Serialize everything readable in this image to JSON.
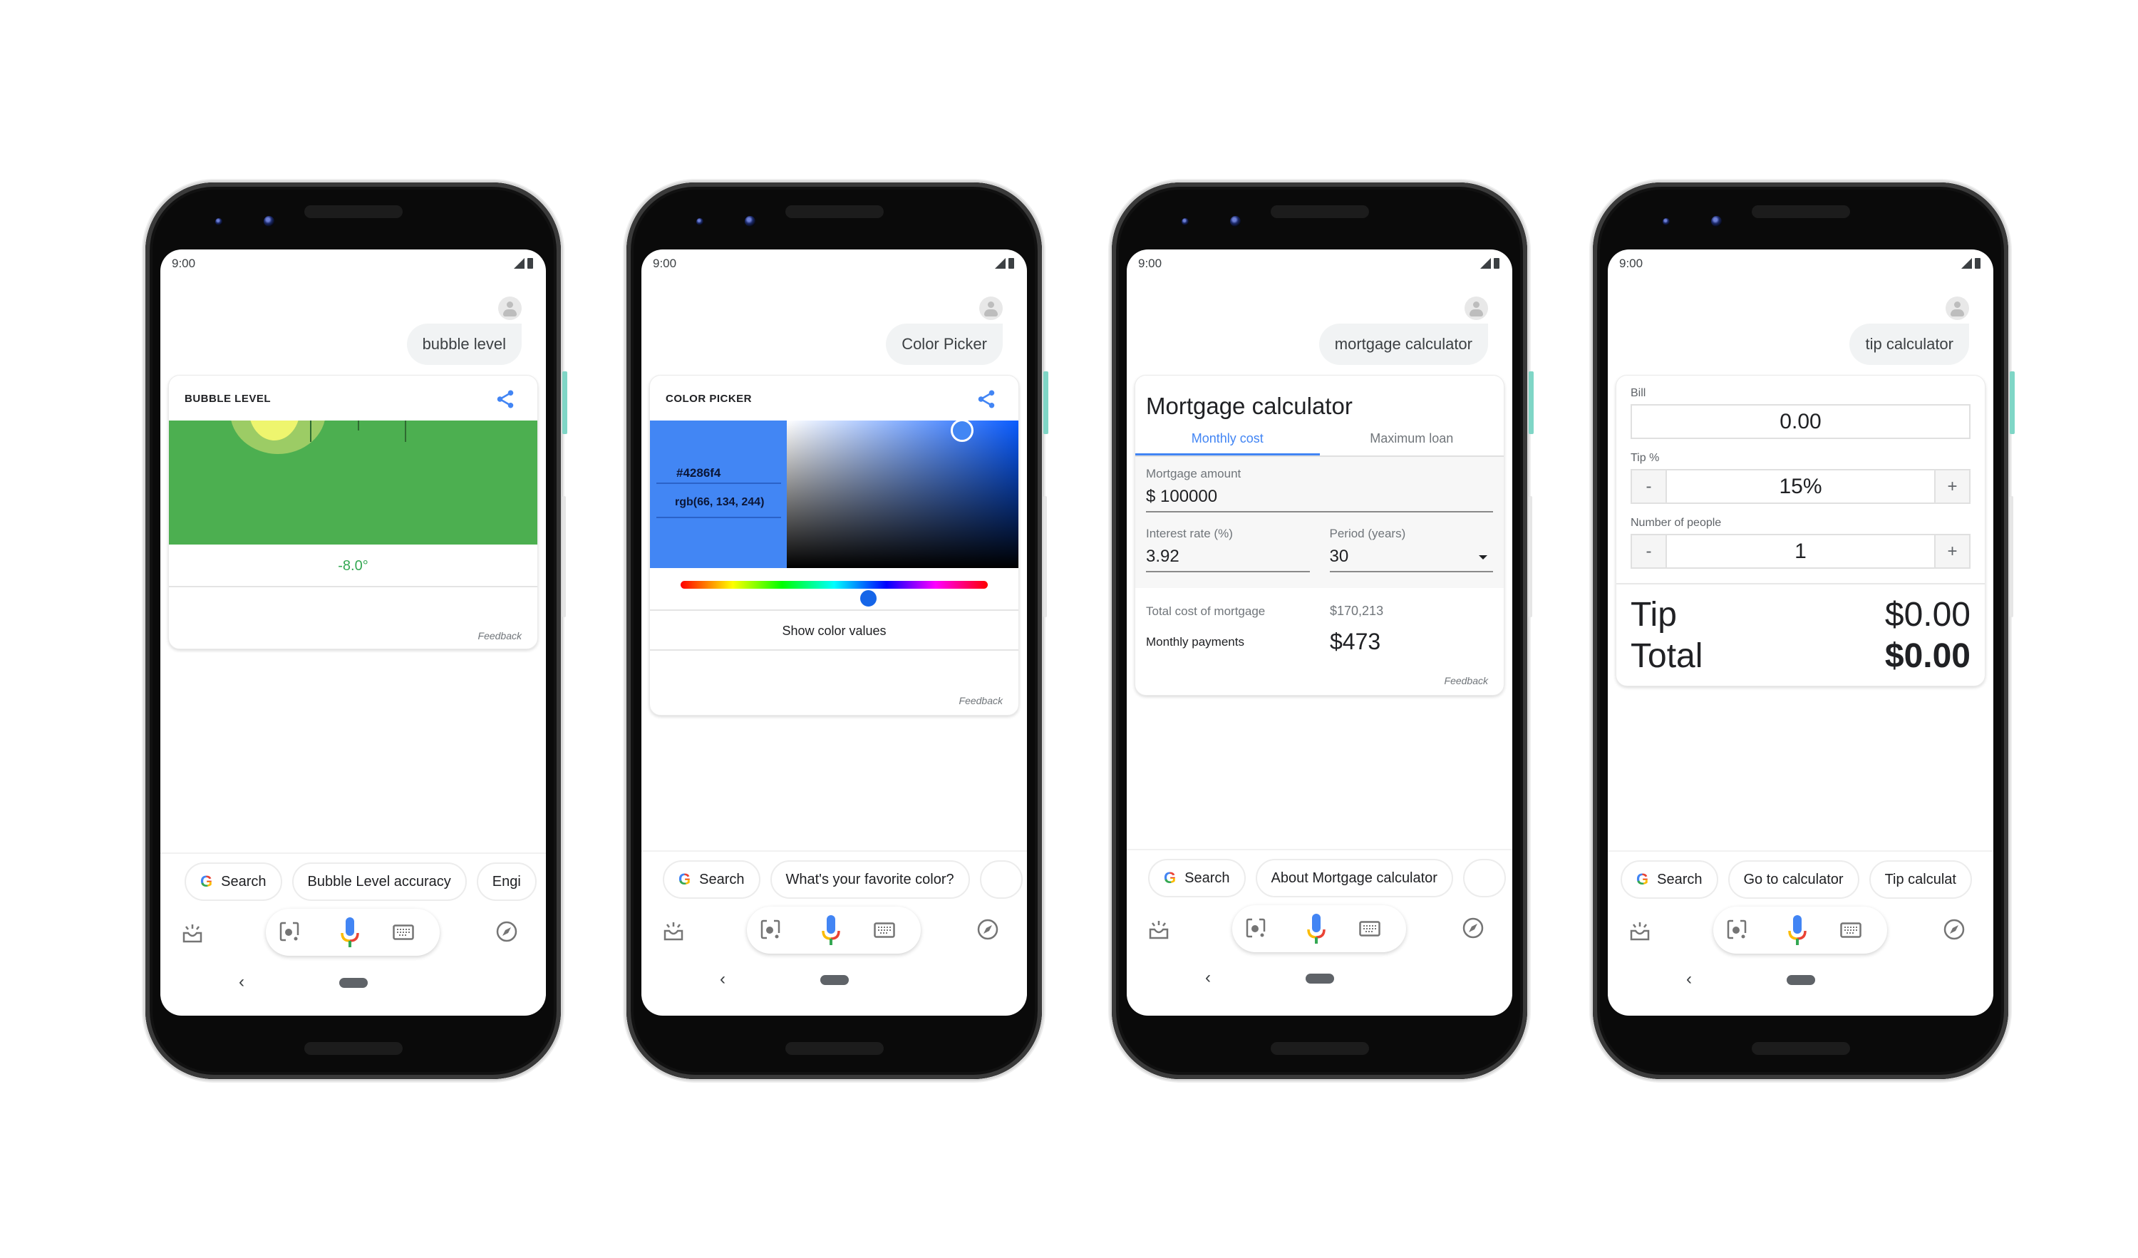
{
  "phones": [
    {
      "status": {
        "time": "9:00"
      },
      "query": "bubble level",
      "card": {
        "title": "BUBBLE LEVEL",
        "reading": "-8.0°",
        "feedback": "Feedback"
      },
      "chips": [
        "Search",
        "Bubble Level accuracy",
        "Engi"
      ],
      "colors": {
        "level_green": "#4caf50",
        "bubble_yellow": "#eef56e",
        "reading_green": "#34a853"
      }
    },
    {
      "status": {
        "time": "9:00"
      },
      "query": "Color Picker",
      "card": {
        "title": "COLOR PICKER",
        "hex": "#4286f4",
        "rgb": "rgb(66, 134, 244)",
        "selected_color": "#4286f4",
        "hue_position": 0.61,
        "show_values_label": "Show color values",
        "feedback": "Feedback"
      },
      "chips": [
        "Search",
        "What's your favorite color?",
        ""
      ]
    },
    {
      "status": {
        "time": "9:00"
      },
      "query": "mortgage calculator",
      "card": {
        "title": "Mortgage calculator",
        "tabs": [
          {
            "label": "Monthly cost",
            "active": true
          },
          {
            "label": "Maximum loan",
            "active": false
          }
        ],
        "mortgage_amount_label": "Mortgage amount",
        "mortgage_amount_value": "$ 100000",
        "interest_label": "Interest rate (%)",
        "interest_value": "3.92",
        "period_label": "Period (years)",
        "period_value": "30",
        "total_cost_label": "Total cost of mortgage",
        "total_cost_value": "$170,213",
        "monthly_label": "Monthly payments",
        "monthly_value": "$473",
        "feedback": "Feedback"
      },
      "chips": [
        "Search",
        "About Mortgage calculator",
        ""
      ]
    },
    {
      "status": {
        "time": "9:00"
      },
      "query": "tip calculator",
      "card": {
        "bill_label": "Bill",
        "bill_value": "0.00",
        "tip_label": "Tip %",
        "tip_value": "15%",
        "people_label": "Number of people",
        "people_value": "1",
        "minus": "-",
        "plus": "+",
        "tip_result_label": "Tip",
        "tip_result_value": "$0.00",
        "total_label": "Total",
        "total_value": "$0.00"
      },
      "chips": [
        "Search",
        "Go to calculator",
        "Tip calculat"
      ]
    }
  ],
  "accent": "#4285f4"
}
